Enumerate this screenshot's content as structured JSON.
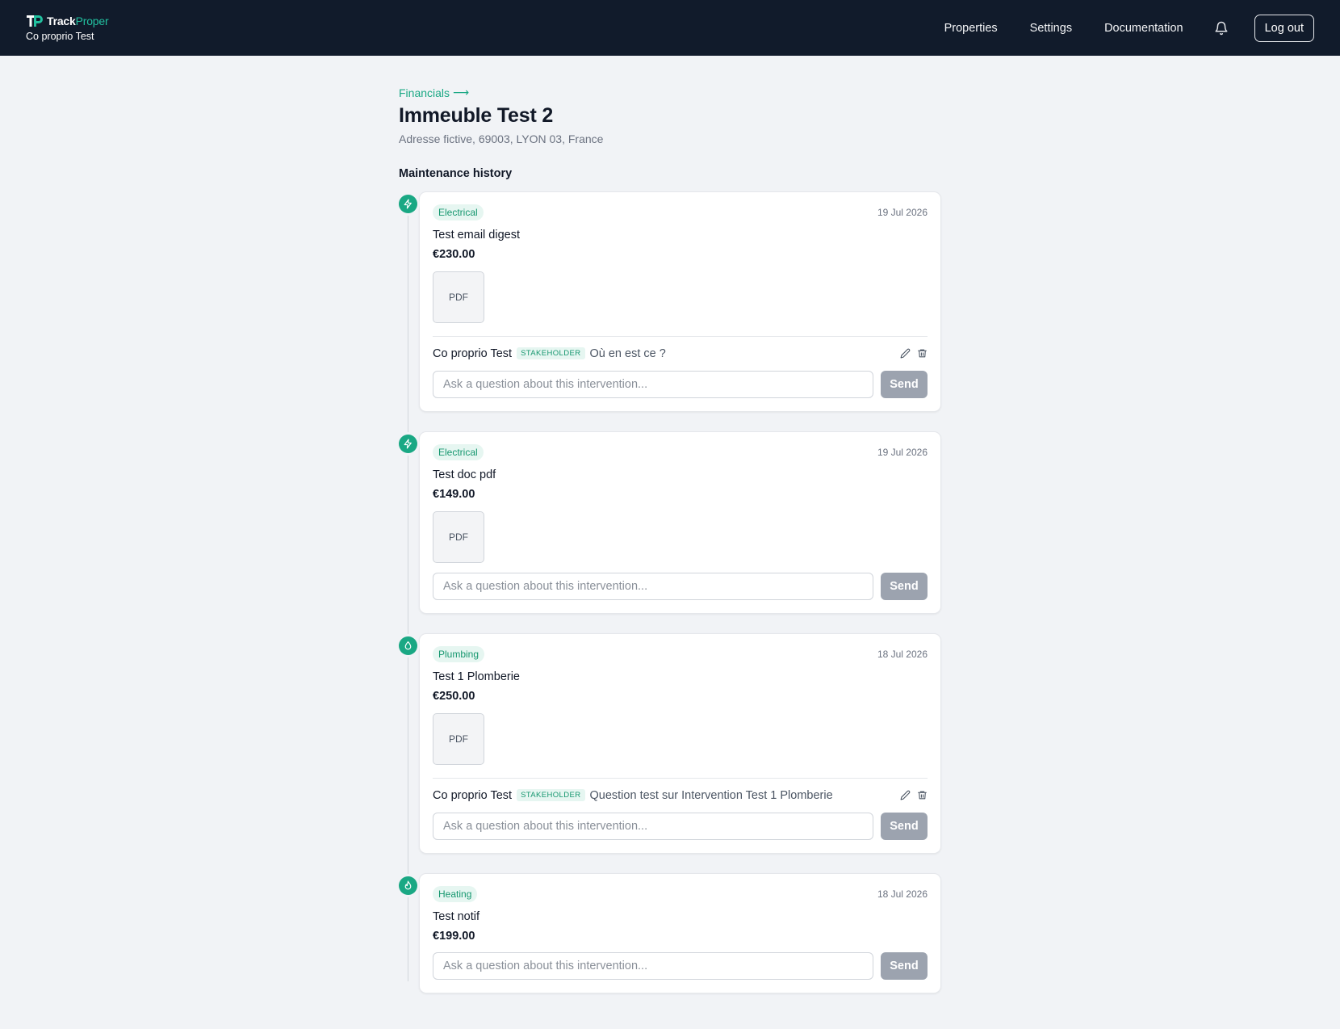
{
  "header": {
    "brand_prefix": "Track",
    "brand_suffix": "Proper",
    "user_name": "Co proprio Test",
    "nav": [
      "Properties",
      "Settings",
      "Documentation"
    ],
    "logout_label": "Log out"
  },
  "page": {
    "breadcrumb": "Financials",
    "breadcrumb_arrow": "⟶",
    "title": "Immeuble Test 2",
    "address": "Adresse fictive, 69003, LYON 03, France",
    "section_title": "Maintenance history"
  },
  "composer": {
    "placeholder": "Ask a question about this intervention...",
    "send_label": "Send"
  },
  "interventions": [
    {
      "category": "Electrical",
      "icon": "lightning-icon",
      "date": "19 Jul 2026",
      "title": "Test email digest",
      "amount": "€230.00",
      "attachment": "PDF",
      "comment": {
        "author": "Co proprio Test",
        "role": "STAKEHOLDER",
        "text": "Où en est ce ?"
      }
    },
    {
      "category": "Electrical",
      "icon": "lightning-icon",
      "date": "19 Jul 2026",
      "title": "Test doc pdf",
      "amount": "€149.00",
      "attachment": "PDF"
    },
    {
      "category": "Plumbing",
      "icon": "water-drop-icon",
      "date": "18 Jul 2026",
      "title": "Test 1 Plomberie",
      "amount": "€250.00",
      "attachment": "PDF",
      "comment": {
        "author": "Co proprio Test",
        "role": "STAKEHOLDER",
        "text": "Question test sur Intervention Test 1 Plomberie"
      }
    },
    {
      "category": "Heating",
      "icon": "flame-icon",
      "date": "18 Jul 2026",
      "title": "Test notif",
      "amount": "€199.00"
    }
  ],
  "colors": {
    "header_bg": "#111b2b",
    "accent": "#1aa884",
    "page_bg": "#f1f3f6",
    "send_button": "#9ca3af"
  }
}
